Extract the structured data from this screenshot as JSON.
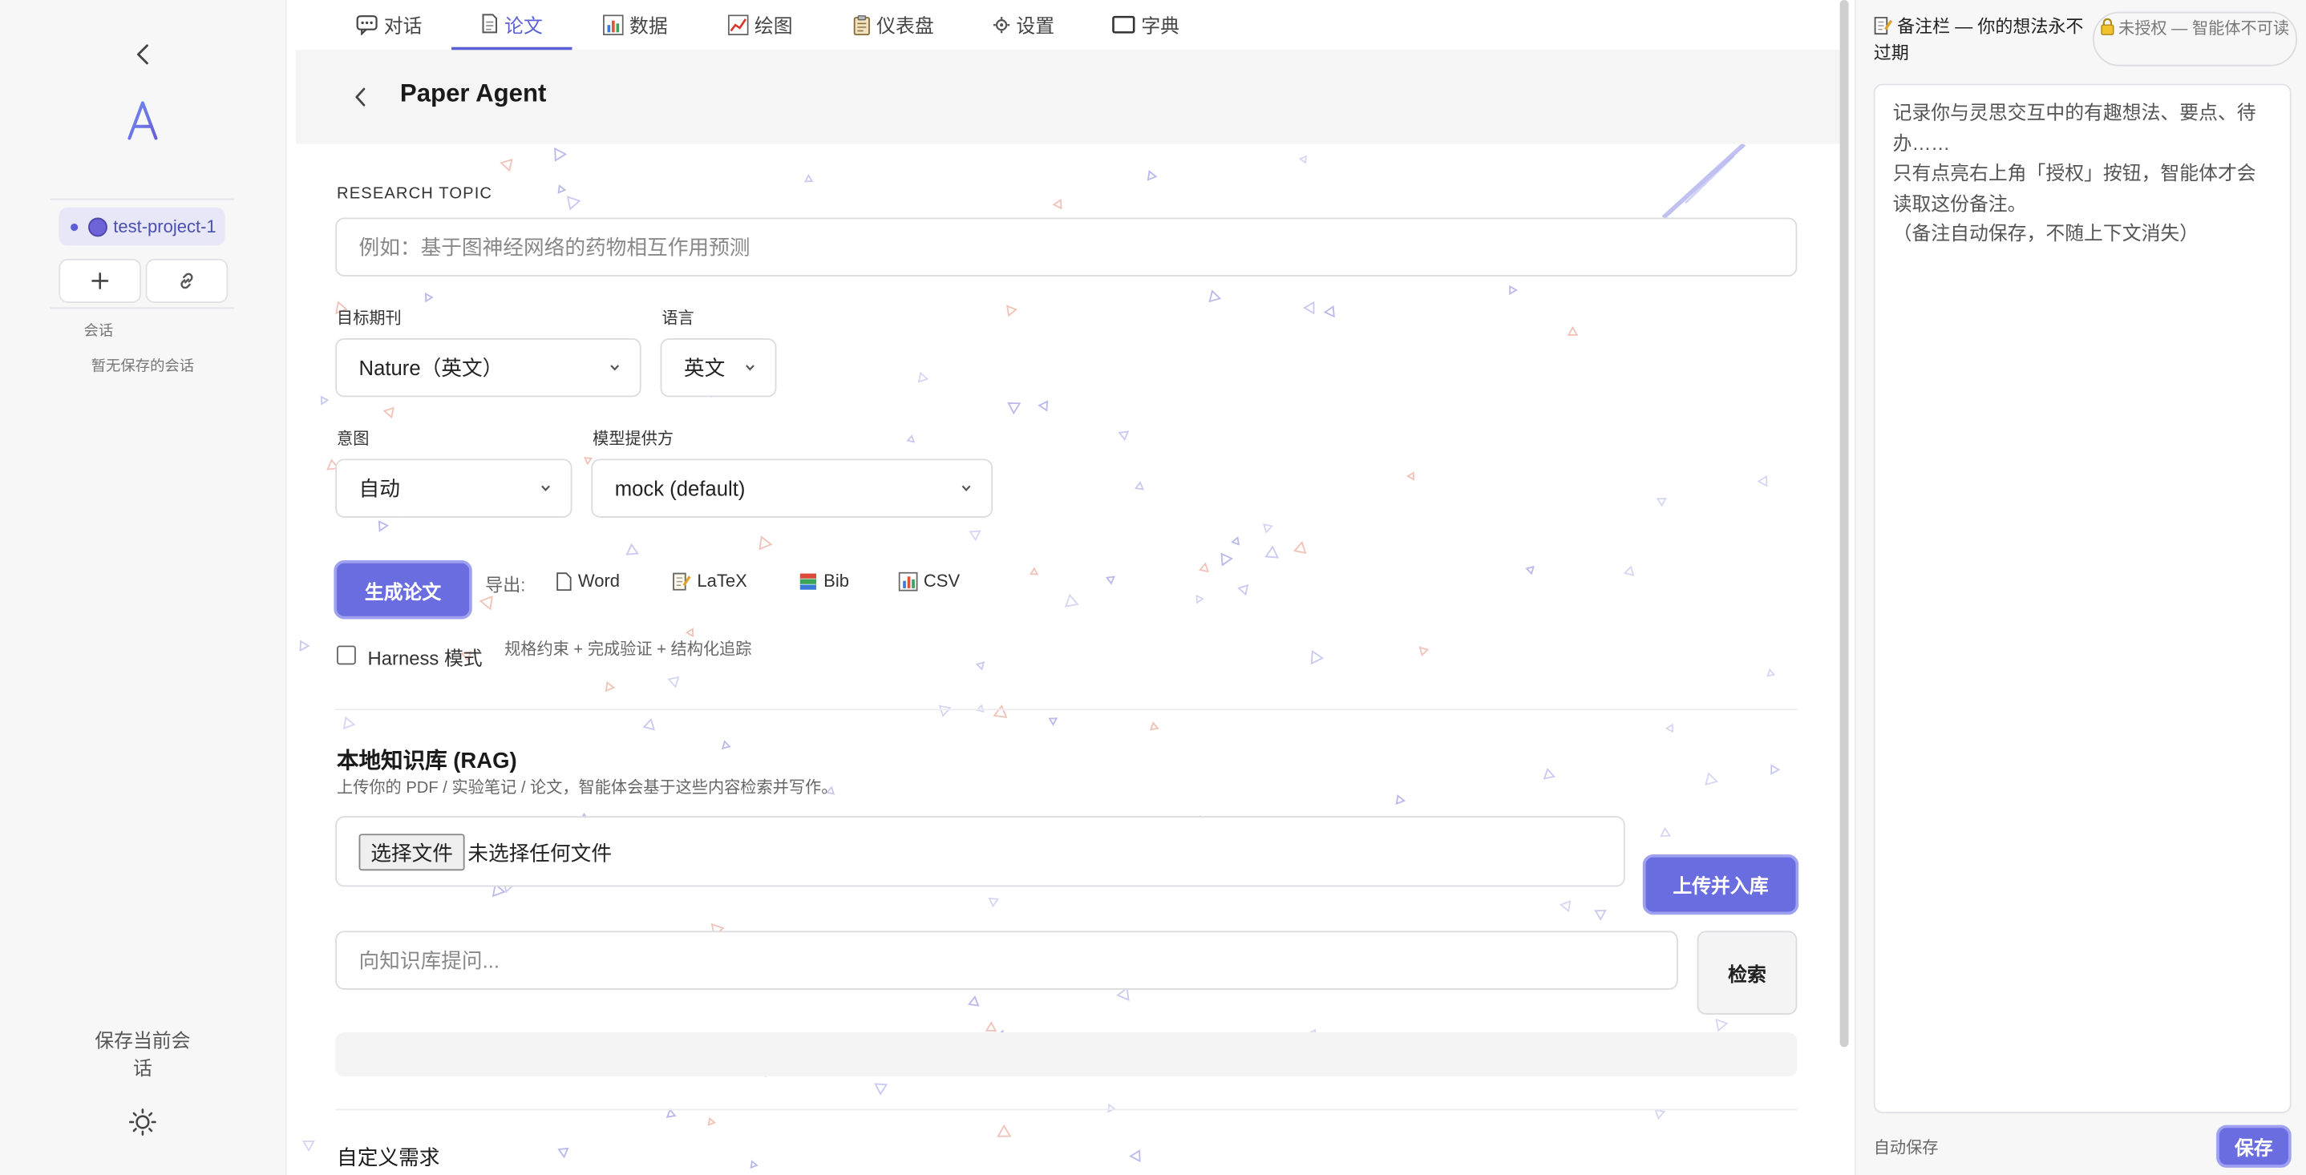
{
  "sidebar": {
    "project_name": "test-project-1",
    "sessions_label": "会话",
    "no_sessions": "暂无保存的会话",
    "save_session": "保存当前会话"
  },
  "tabs": [
    {
      "label": "对话",
      "icon": "speech-bubble-icon"
    },
    {
      "label": "论文",
      "icon": "document-icon"
    },
    {
      "label": "数据",
      "icon": "bar-chart-icon"
    },
    {
      "label": "绘图",
      "icon": "line-chart-icon"
    },
    {
      "label": "仪表盘",
      "icon": "clipboard-icon"
    },
    {
      "label": "设置",
      "icon": "gear-icon"
    },
    {
      "label": "字典",
      "icon": "monitor-icon"
    }
  ],
  "active_tab": "论文",
  "header": {
    "title": "Paper Agent"
  },
  "form": {
    "topic_label": "RESEARCH TOPIC",
    "topic_placeholder": "例如：基于图神经网络的药物相互作用预测",
    "journal_label": "目标期刊",
    "journal_value": "Nature（英文）",
    "language_label": "语言",
    "language_value": "英文",
    "intent_label": "意图",
    "intent_value": "自动",
    "provider_label": "模型提供方",
    "provider_value": "mock (default)",
    "generate_button": "生成论文",
    "export_label": "导出:",
    "exports": [
      "Word",
      "LaTeX",
      "Bib",
      "CSV"
    ],
    "harness_label": "Harness 模式",
    "harness_checked": false,
    "harness_hint": "规格约束 + 完成验证 + 结构化追踪"
  },
  "rag": {
    "title": "本地知识库 (RAG)",
    "subtitle": "上传你的 PDF / 实验笔记 / 论文，智能体会基于这些内容检索并写作。",
    "choose_file": "选择文件",
    "no_file": "未选择任何文件",
    "upload_button": "上传并入库",
    "query_placeholder": "向知识库提问...",
    "search_button": "检索"
  },
  "custom": {
    "title": "自定义需求"
  },
  "notes": {
    "title": "备注栏 — 你的想法永不过期",
    "auth_status": "未授权 — 智能体不可读",
    "content": "记录你与灵思交互中的有趣想法、要点、待办……\n只有点亮右上角「授权」按钮，智能体才会读取这份备注。\n（备注自动保存，不随上下文消失）",
    "autosave": "自动保存",
    "save_button": "保存"
  },
  "colors": {
    "accent": "#5b5fd6",
    "primary_button": "#6a6de0"
  }
}
